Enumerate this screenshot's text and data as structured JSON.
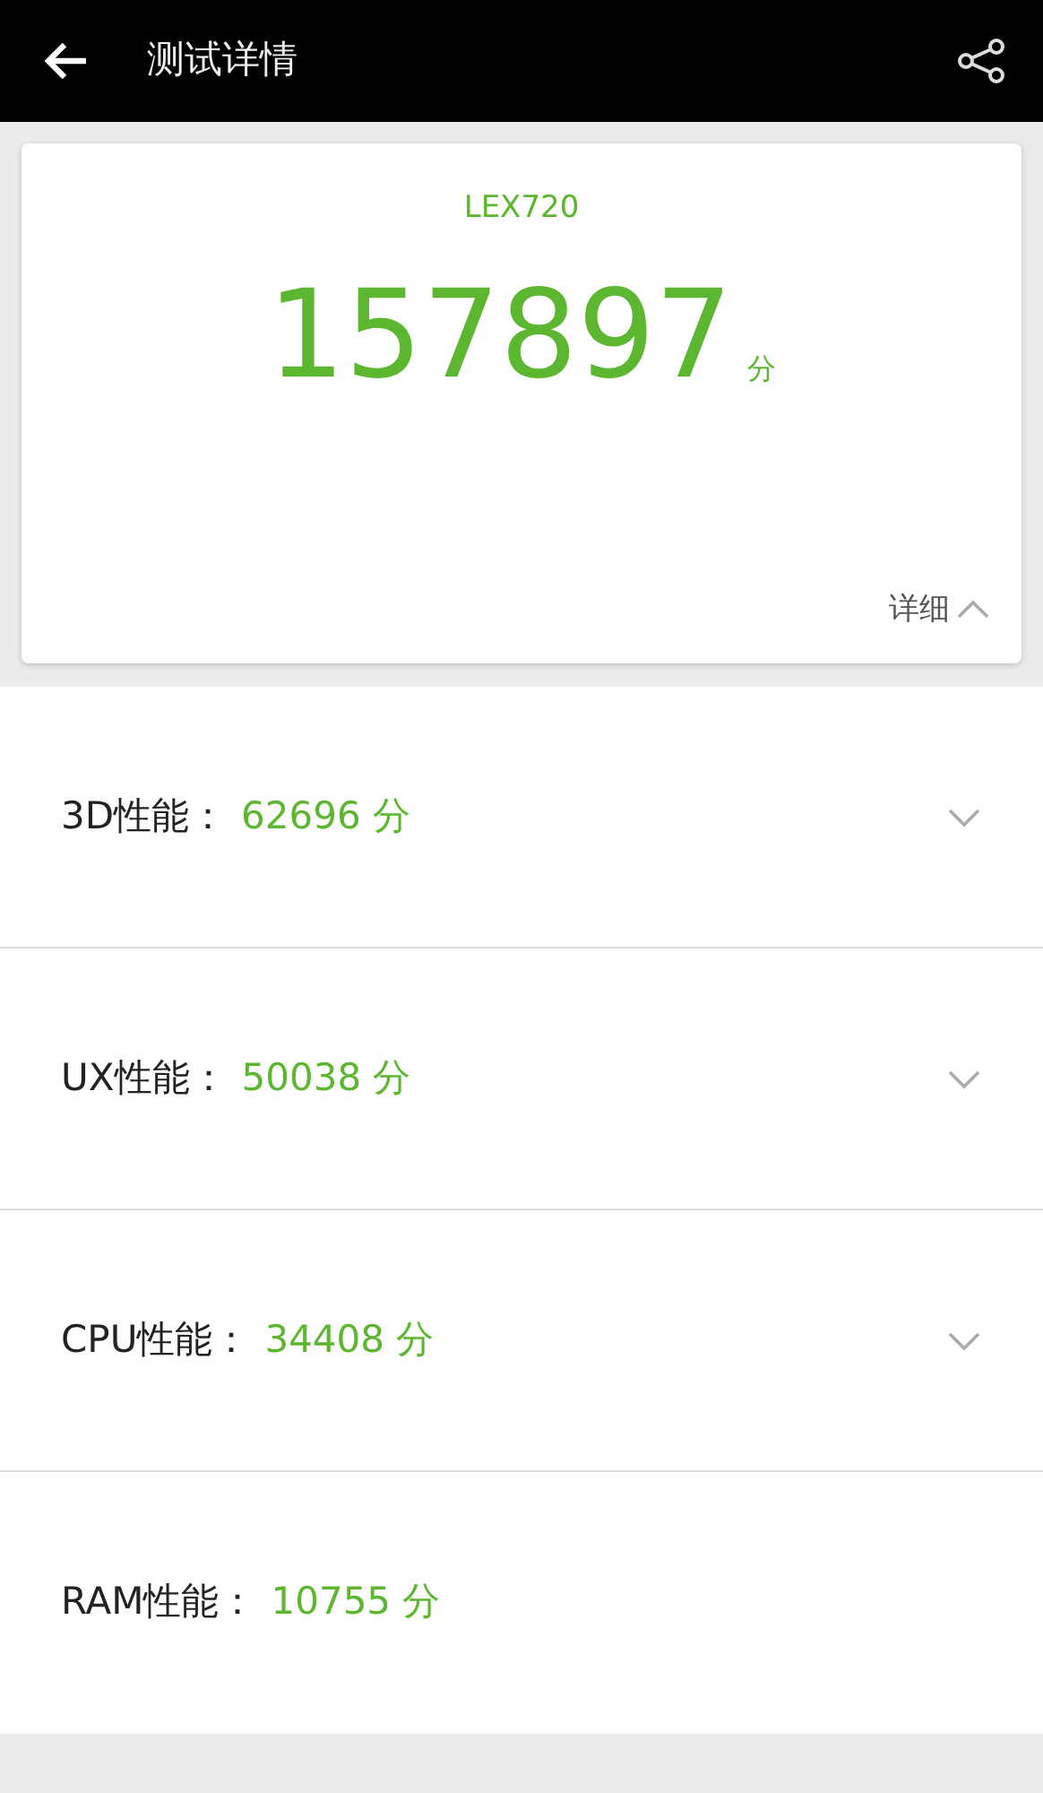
{
  "header": {
    "title": "测试详情"
  },
  "summary": {
    "device": "LEX720",
    "score": "157897",
    "unit": "分",
    "details_label": "详细",
    "details_expanded": true
  },
  "results": [
    {
      "label": "3D性能：",
      "score": "62696",
      "unit": "分",
      "expandable": true
    },
    {
      "label": "UX性能：",
      "score": "50038",
      "unit": "分",
      "expandable": true
    },
    {
      "label": "CPU性能：",
      "score": "34408",
      "unit": "分",
      "expandable": true
    },
    {
      "label": "RAM性能：",
      "score": "10755",
      "unit": "分",
      "expandable": false
    }
  ]
}
